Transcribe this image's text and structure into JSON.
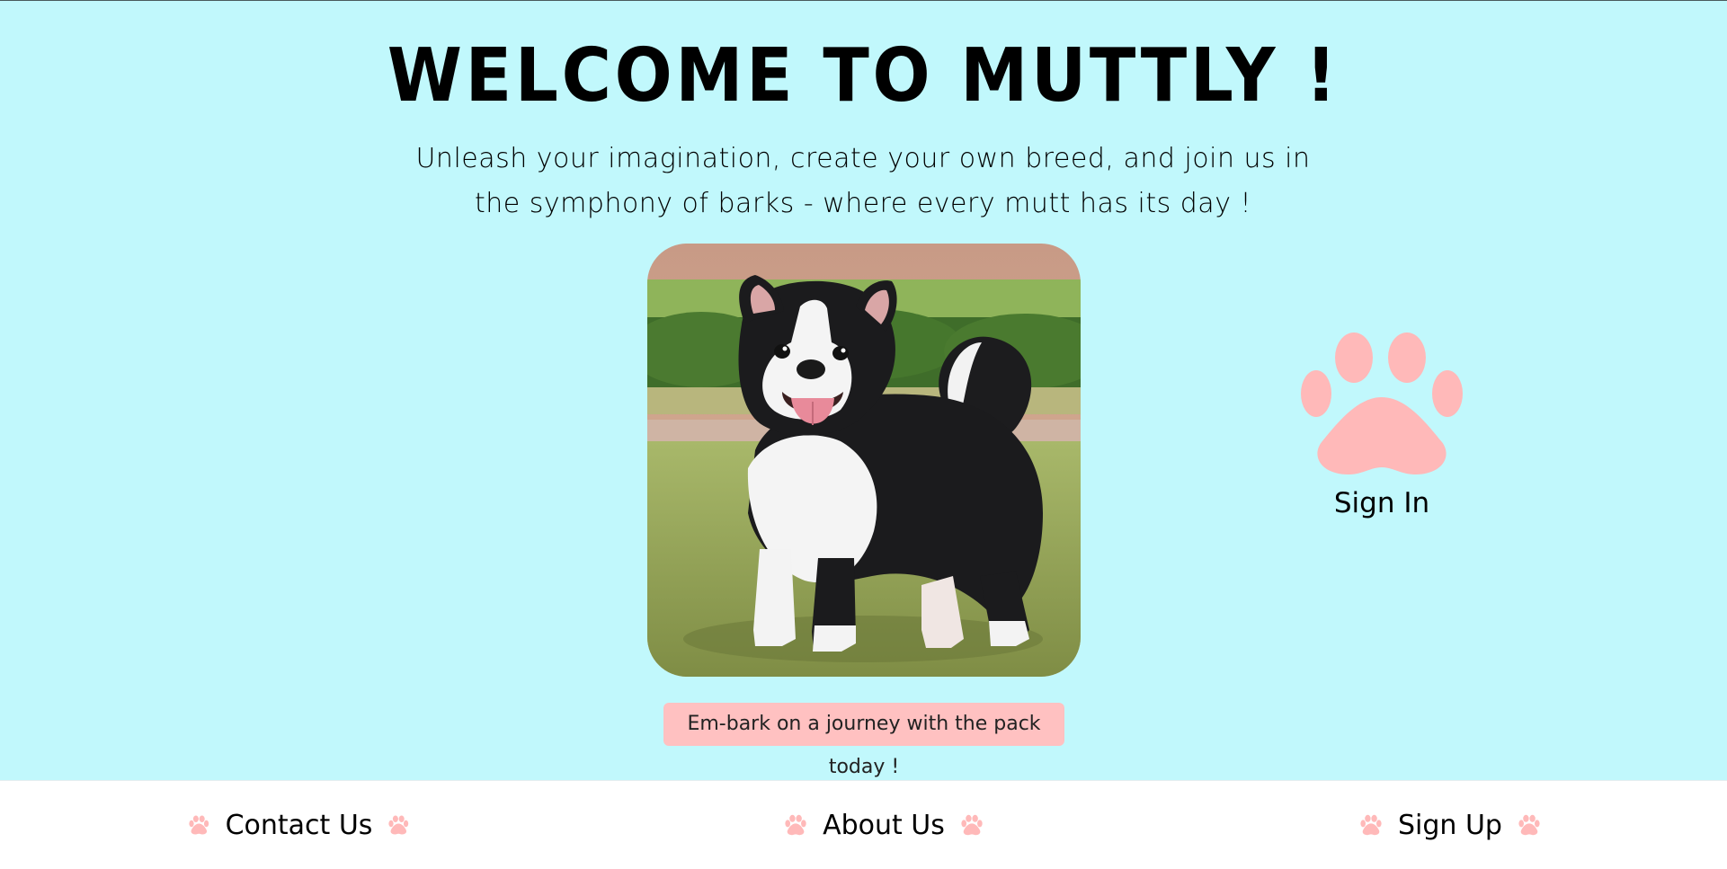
{
  "header": {
    "title": "WELCOME TO MUTTLY !",
    "subtitle": "Unleash your imagination, create your own breed, and join us in the symphony of barks - where every mutt has its day !"
  },
  "hero": {
    "image_icon": "dog-photo",
    "cta_text": "Em-bark on a journey with the pack today !"
  },
  "signin": {
    "icon": "paw-icon",
    "label": "Sign In"
  },
  "footer": {
    "links": [
      {
        "label": "Contact Us",
        "icon": "paw-icon"
      },
      {
        "label": "About Us",
        "icon": "paw-icon"
      },
      {
        "label": "Sign Up",
        "icon": "paw-icon"
      }
    ]
  },
  "colors": {
    "background": "#c1f8fc",
    "paw": "#ffb9b9",
    "cta_background": "#ffc1c1",
    "footer_background": "#ffffff"
  }
}
